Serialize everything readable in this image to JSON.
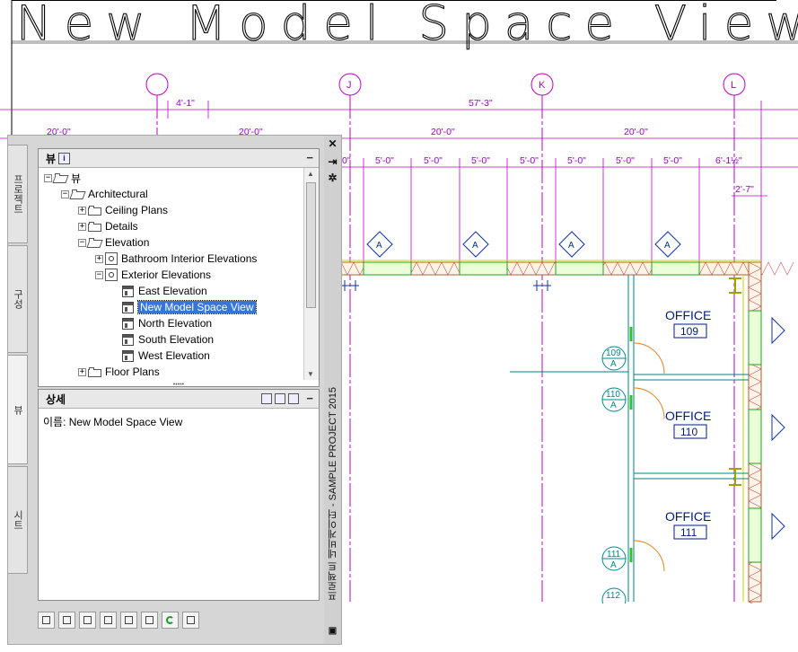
{
  "drawing": {
    "view_title": "New Model Space View",
    "grid_bubbles": [
      "J",
      "K",
      "L"
    ],
    "dimensions": {
      "top_row": [
        "4'-1\"",
        "57'-3\""
      ],
      "second_row": [
        "20'-0\"",
        "20'-0\"",
        "20'-0\"",
        "20'-0\""
      ],
      "third_row": [
        "0\"",
        "5'-0\"",
        "5'-0\"",
        "5'-0\"",
        "5'-0\"",
        "5'-0\"",
        "5'-0\"",
        "5'-0\"",
        "6'-1½\""
      ],
      "side": "2'-7\""
    },
    "elevation_tag": "A",
    "rooms": [
      {
        "name": "OFFICE",
        "number": "109"
      },
      {
        "name": "OFFICE",
        "number": "110"
      },
      {
        "name": "OFFICE",
        "number": "111"
      }
    ],
    "door_tags": [
      {
        "number": "109",
        "letter": "A"
      },
      {
        "number": "110",
        "letter": "A"
      },
      {
        "number": "111",
        "letter": "A"
      },
      {
        "number": "112",
        "letter": ""
      }
    ]
  },
  "palette": {
    "title": "프로젝트 네비게이터 - SAMPLE PROJECT 2015",
    "side_tabs": [
      "프로젝트",
      "구성",
      "뷰",
      "시트"
    ],
    "view_pane": {
      "header": "뷰",
      "info_icon": "i",
      "minimize": "−",
      "tree": [
        {
          "label": "뷰",
          "level": 0,
          "icon": "folder-open",
          "toggle": "−"
        },
        {
          "label": "Architectural",
          "level": 1,
          "icon": "folder-open",
          "toggle": "−"
        },
        {
          "label": "Ceiling Plans",
          "level": 2,
          "icon": "folder",
          "toggle": "+"
        },
        {
          "label": "Details",
          "level": 2,
          "icon": "folder",
          "toggle": "+"
        },
        {
          "label": "Elevation",
          "level": 2,
          "icon": "folder-open",
          "toggle": "−"
        },
        {
          "label": "Bathroom Interior Elevations",
          "level": 3,
          "icon": "elevation-view",
          "toggle": "+"
        },
        {
          "label": "Exterior Elevations",
          "level": 3,
          "icon": "elevation-view",
          "toggle": "−"
        },
        {
          "label": "East Elevation",
          "level": 4,
          "icon": "sheet-view",
          "toggle": ""
        },
        {
          "label": "New Model Space View",
          "level": 4,
          "icon": "sheet-view",
          "toggle": "",
          "selected": true
        },
        {
          "label": "North Elevation",
          "level": 4,
          "icon": "sheet-view",
          "toggle": ""
        },
        {
          "label": "South Elevation",
          "level": 4,
          "icon": "sheet-view",
          "toggle": ""
        },
        {
          "label": "West Elevation",
          "level": 4,
          "icon": "sheet-view",
          "toggle": ""
        },
        {
          "label": "Floor Plans",
          "level": 2,
          "icon": "folder",
          "toggle": "+"
        }
      ]
    },
    "detail_pane": {
      "header": "상세",
      "minimize": "−",
      "name_label": "이름:",
      "name_value": "New Model Space View"
    },
    "toolbar_icons": [
      "add-view-icon",
      "add-category-icon",
      "regenerate-icon",
      "clipboard-icon",
      "properties-icon",
      "table-icon",
      "refresh-icon",
      "tree-icon"
    ]
  }
}
